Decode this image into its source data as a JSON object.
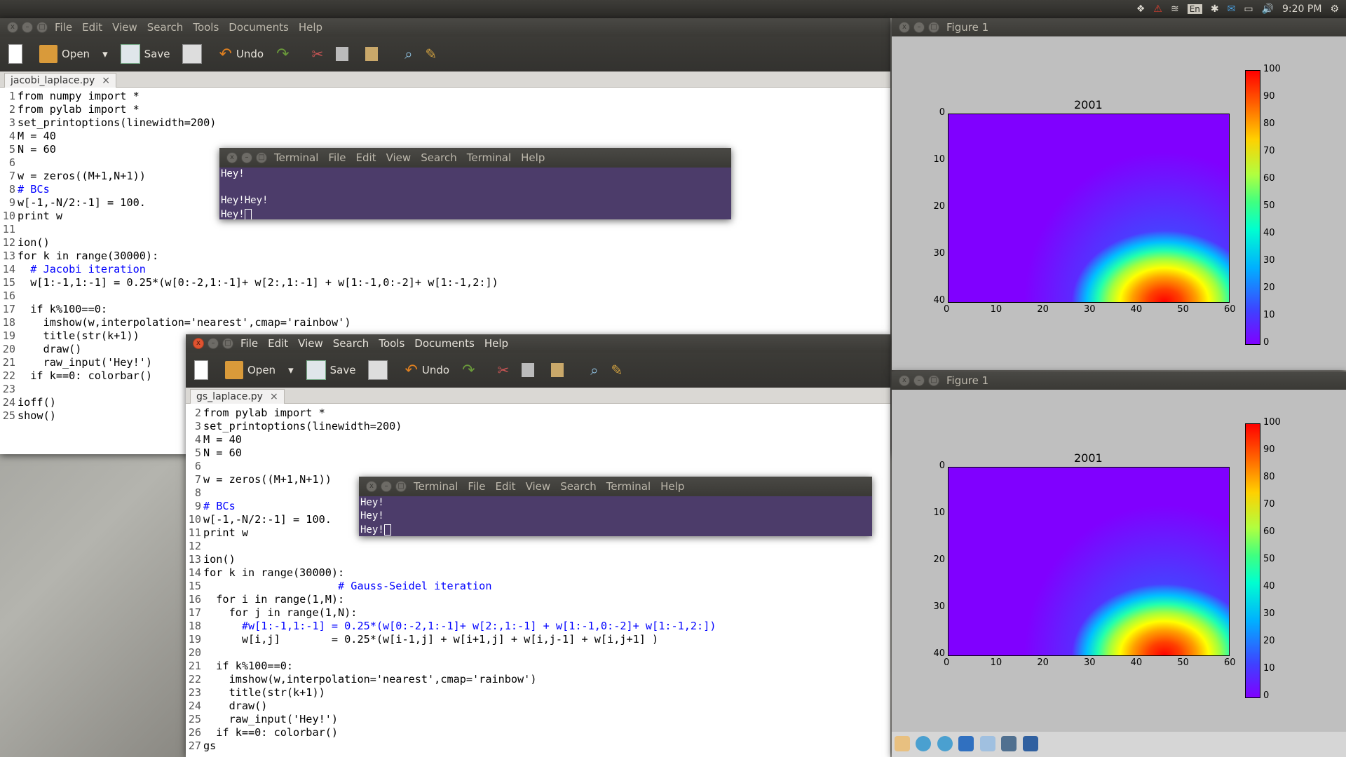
{
  "panel": {
    "lang": "En",
    "time": "9:20 PM"
  },
  "gedit1": {
    "menu": [
      "File",
      "Edit",
      "View",
      "Search",
      "Tools",
      "Documents",
      "Help"
    ],
    "toolbar": {
      "open": "Open",
      "save": "Save",
      "undo": "Undo"
    },
    "tab": "jacobi_laplace.py",
    "lines": [
      "from numpy import *",
      "from pylab import *",
      "set_printoptions(linewidth=200)",
      "M = 40",
      "N = 60",
      "",
      "w = zeros((M+1,N+1))",
      "# BCs",
      "w[-1,-N/2:-1] = 100.",
      "print w",
      "",
      "ion()",
      "for k in range(30000):",
      "  # Jacobi iteration",
      "  w[1:-1,1:-1] = 0.25*(w[0:-2,1:-1]+ w[2:,1:-1] + w[1:-1,0:-2]+ w[1:-1,2:])",
      "",
      "  if k%100==0:",
      "    imshow(w,interpolation='nearest',cmap='rainbow')",
      "    title(str(k+1))",
      "    draw()",
      "    raw_input('Hey!')",
      "  if k==0: colorbar()",
      "",
      "ioff()",
      "show()"
    ]
  },
  "term1": {
    "menu": [
      "Terminal",
      "File",
      "Edit",
      "View",
      "Search",
      "Terminal",
      "Help"
    ],
    "output": [
      "Hey!",
      "",
      "Hey!Hey!",
      "Hey!"
    ]
  },
  "gedit2": {
    "menu": [
      "File",
      "Edit",
      "View",
      "Search",
      "Tools",
      "Documents",
      "Help"
    ],
    "toolbar": {
      "open": "Open",
      "save": "Save",
      "undo": "Undo"
    },
    "tab": "gs_laplace.py",
    "lines": [
      "from pylab import *",
      "set_printoptions(linewidth=200)",
      "M = 40",
      "N = 60",
      "",
      "w = zeros((M+1,N+1))",
      "",
      "# BCs",
      "w[-1,-N/2:-1] = 100.",
      "print w",
      "",
      "ion()",
      "for k in range(30000):",
      "                     # Gauss-Seidel iteration",
      "  for i in range(1,M):",
      "    for j in range(1,N):",
      "      #w[1:-1,1:-1] = 0.25*(w[0:-2,1:-1]+ w[2:,1:-1] + w[1:-1,0:-2]+ w[1:-1,2:])",
      "      w[i,j]        = 0.25*(w[i-1,j] + w[i+1,j] + w[i,j-1] + w[i,j+1] )",
      "",
      "  if k%100==0:",
      "    imshow(w,interpolation='nearest',cmap='rainbow')",
      "    title(str(k+1))",
      "    draw()",
      "    raw_input('Hey!')",
      "  if k==0: colorbar()",
      "gs"
    ]
  },
  "term2": {
    "menu": [
      "Terminal",
      "File",
      "Edit",
      "View",
      "Search",
      "Terminal",
      "Help"
    ],
    "output": [
      "Hey!",
      "Hey!",
      "Hey!"
    ]
  },
  "figure1": {
    "title": "Figure 1",
    "plot_title": "2001",
    "xticks": [
      "0",
      "10",
      "20",
      "30",
      "40",
      "50",
      "60"
    ],
    "yticks": [
      "0",
      "10",
      "20",
      "30",
      "40"
    ],
    "cbar_ticks": [
      "100",
      "90",
      "80",
      "70",
      "60",
      "50",
      "40",
      "30",
      "20",
      "10",
      "0"
    ]
  },
  "figure2": {
    "title": "Figure 1",
    "plot_title": "2001",
    "xticks": [
      "0",
      "10",
      "20",
      "30",
      "40",
      "50",
      "60"
    ],
    "yticks": [
      "0",
      "10",
      "20",
      "30",
      "40"
    ],
    "cbar_ticks": [
      "100",
      "90",
      "80",
      "70",
      "60",
      "50",
      "40",
      "30",
      "20",
      "10",
      "0"
    ]
  },
  "chart_data": [
    {
      "type": "heatmap",
      "title": "2001",
      "xlim": [
        0,
        60
      ],
      "ylim": [
        40,
        0
      ],
      "colorbar": [
        0,
        100
      ],
      "cmap": "rainbow"
    },
    {
      "type": "heatmap",
      "title": "2001",
      "xlim": [
        0,
        60
      ],
      "ylim": [
        40,
        0
      ],
      "colorbar": [
        0,
        100
      ],
      "cmap": "rainbow"
    }
  ]
}
